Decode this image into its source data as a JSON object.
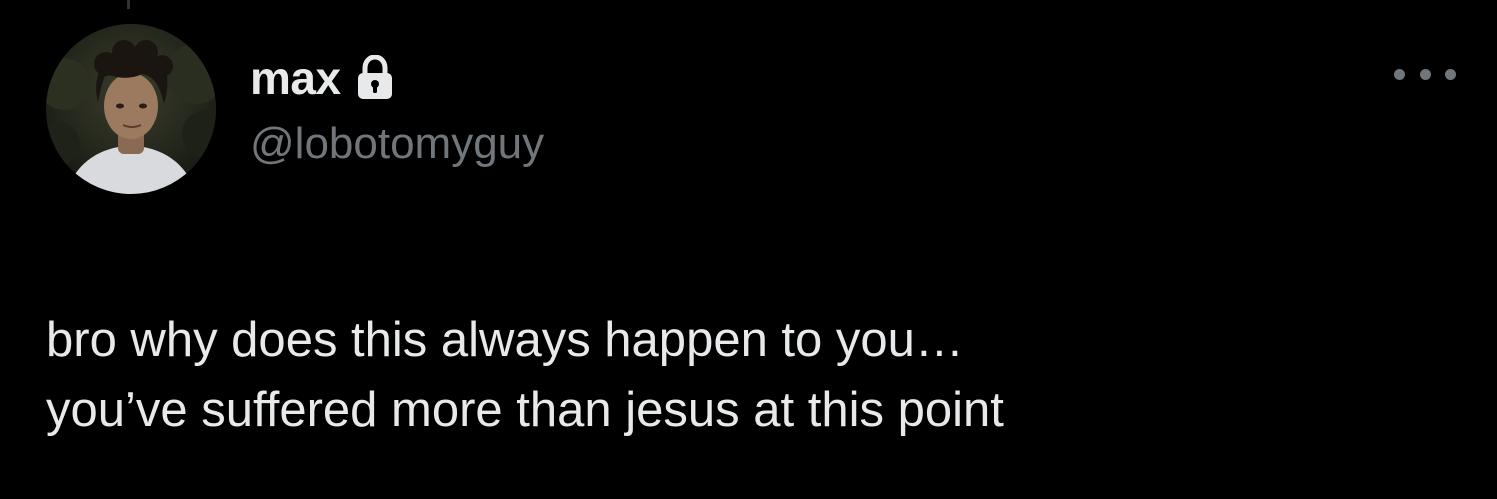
{
  "author": {
    "display_name": "max",
    "handle": "@lobotomyguy",
    "protected_icon": "lock-icon",
    "avatar_icon": "profile-photo"
  },
  "menu": {
    "more_icon": "more-horizontal-icon"
  },
  "tweet": {
    "lines": [
      "bro why does this always happen to you…",
      "you’ve suffered more than jesus at this point"
    ]
  },
  "colors": {
    "background": "#000000",
    "primary_text": "#e7e9ea",
    "secondary_text": "#71767b"
  }
}
